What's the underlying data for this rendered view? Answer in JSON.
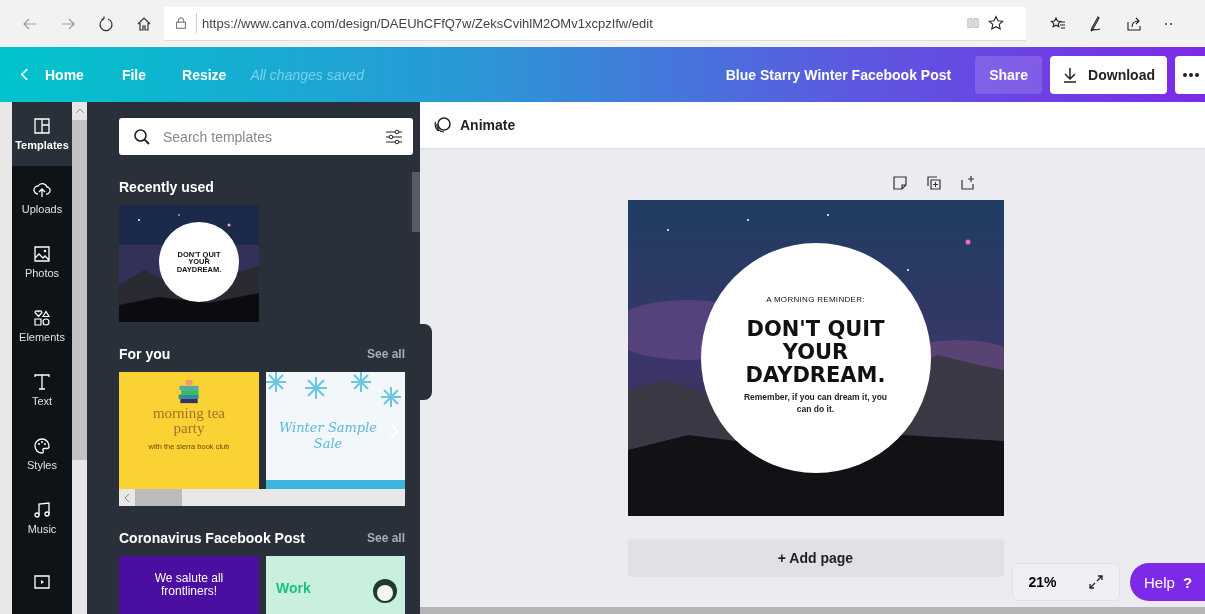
{
  "browser": {
    "url": "https://www.canva.com/design/DAEUhCFfQ7w/ZeksCvihlM2OMv1xcpzIfw/edit"
  },
  "topbar": {
    "home": "Home",
    "menu": [
      "File",
      "Resize"
    ],
    "save_status": "All changes saved",
    "design_title": "Blue Starry Winter Facebook Post",
    "share": "Share",
    "download": "Download"
  },
  "sidebar": {
    "items": [
      {
        "label": "Templates",
        "selected": true
      },
      {
        "label": "Uploads",
        "selected": false
      },
      {
        "label": "Photos",
        "selected": false
      },
      {
        "label": "Elements",
        "selected": false
      },
      {
        "label": "Text",
        "selected": false
      },
      {
        "label": "Styles",
        "selected": false
      },
      {
        "label": "Music",
        "selected": false
      },
      {
        "selected": false
      }
    ]
  },
  "panel": {
    "search": {
      "placeholder": "Search templates"
    },
    "sections": [
      {
        "title": "Recently used",
        "templates": [
          {
            "kind": "starry",
            "lines": [
              "DON'T QUIT",
              "YOUR",
              "DAYDREAM."
            ]
          }
        ]
      },
      {
        "title": "For you",
        "see_all": "See all",
        "kind": "carousel",
        "templates": [
          {
            "kind": "tea",
            "title": "morning tea party",
            "subtitle": "with the sierra book club"
          },
          {
            "kind": "winter",
            "title": "Winter Sample Sale"
          }
        ]
      },
      {
        "title": "Coronavirus Facebook Post",
        "see_all": "See all",
        "templates": [
          {
            "kind": "salute",
            "title": "We salute all frontliners!"
          },
          {
            "kind": "work",
            "title": "Work"
          }
        ]
      }
    ]
  },
  "editor": {
    "animate": "Animate",
    "design": {
      "eyebrow": "A MORNING REMINDER:",
      "headline": [
        "DON'T QUIT",
        "YOUR",
        "DAYDREAM."
      ],
      "body": "Remember, if you can dream it, you can do it."
    },
    "add_page": "+ Add page",
    "zoom": "21%",
    "help": "Help",
    "help_icon": "?"
  }
}
